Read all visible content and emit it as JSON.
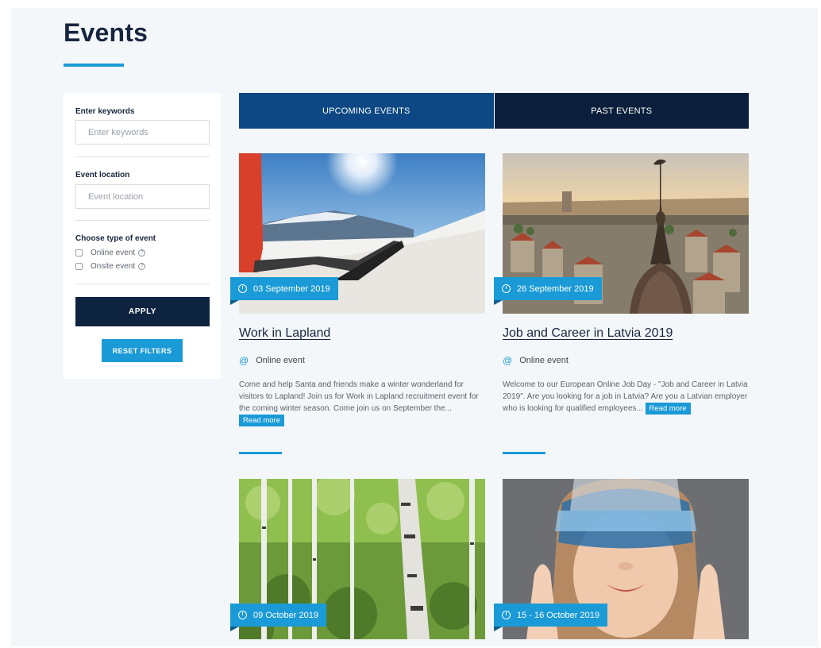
{
  "page": {
    "title": "Events"
  },
  "filters": {
    "keywords_label": "Enter keywords",
    "keywords_placeholder": "Enter keywords",
    "location_label": "Event location",
    "location_placeholder": "Event location",
    "type_label": "Choose type of event",
    "types": [
      {
        "label": "Online event",
        "checked": false
      },
      {
        "label": "Onsite event",
        "checked": false
      }
    ],
    "apply_label": "APPLY",
    "reset_label": "RESET FILTERS"
  },
  "tabs": [
    {
      "label": "UPCOMING EVENTS",
      "active": true
    },
    {
      "label": "PAST EVENTS",
      "active": false
    }
  ],
  "events": [
    {
      "date": "03 September 2019",
      "title": "Work in Lapland",
      "type": "Online event",
      "description": "Come and help Santa and friends make a winter wonderland for visitors to Lapland! Join us for Work in Lapland recruitment event for the coming winter season. Come join us on September the...",
      "read_more": "Read more"
    },
    {
      "date": "26 September 2019",
      "title": "Job and Career in Latvia 2019",
      "type": "Online event",
      "description": "Welcome to our European Online Job Day - \"Job and Career in Latvia 2019\". Are you looking for a job in Latvia? Are you a Latvian employer who is looking for qualified employees...",
      "read_more": "Read more"
    },
    {
      "date": "09 October 2019"
    },
    {
      "date": "15 - 16 October 2019"
    }
  ],
  "colors": {
    "accent": "#1a9ad6",
    "navy": "#0d2340",
    "tab_active": "#0d4784",
    "tab_inactive": "#0b1f3c",
    "title": "#17263f"
  }
}
